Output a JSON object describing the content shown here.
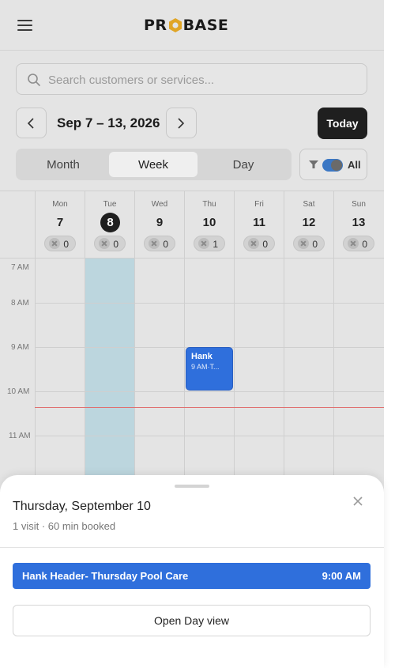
{
  "header": {
    "logo": {
      "left": "PR",
      "right": "BASE"
    }
  },
  "search": {
    "placeholder": "Search customers or services..."
  },
  "nav": {
    "range": "Sep 7 – 13, 2026",
    "today_label": "Today"
  },
  "views": {
    "month": "Month",
    "week": "Week",
    "day": "Day",
    "active": "Week"
  },
  "filter": {
    "label": "All",
    "enabled": true
  },
  "week": {
    "days": [
      {
        "name": "Mon",
        "date": "7",
        "count": "0"
      },
      {
        "name": "Tue",
        "date": "8",
        "count": "0",
        "today": true
      },
      {
        "name": "Wed",
        "date": "9",
        "count": "0"
      },
      {
        "name": "Thu",
        "date": "10",
        "count": "1"
      },
      {
        "name": "Fri",
        "date": "11",
        "count": "0"
      },
      {
        "name": "Sat",
        "date": "12",
        "count": "0"
      },
      {
        "name": "Sun",
        "date": "13",
        "count": "0"
      }
    ],
    "hours": [
      "7 AM",
      "8 AM",
      "9 AM",
      "10 AM",
      "11 AM"
    ]
  },
  "event": {
    "name": "Hank",
    "time": "9 AM·T..."
  },
  "sheet": {
    "title": "Thursday, September 10",
    "subtitle": "1 visit · 60 min booked",
    "visit": {
      "title": "Hank Header- Thursday Pool Care",
      "time": "9:00 AM"
    },
    "open_day_label": "Open Day view"
  },
  "colors": {
    "accent": "#2f6fdc",
    "today_column": "#bcd6de",
    "dark": "#1f1f1f",
    "now_line": "#e07070",
    "logo_hex": "#e0a526"
  }
}
